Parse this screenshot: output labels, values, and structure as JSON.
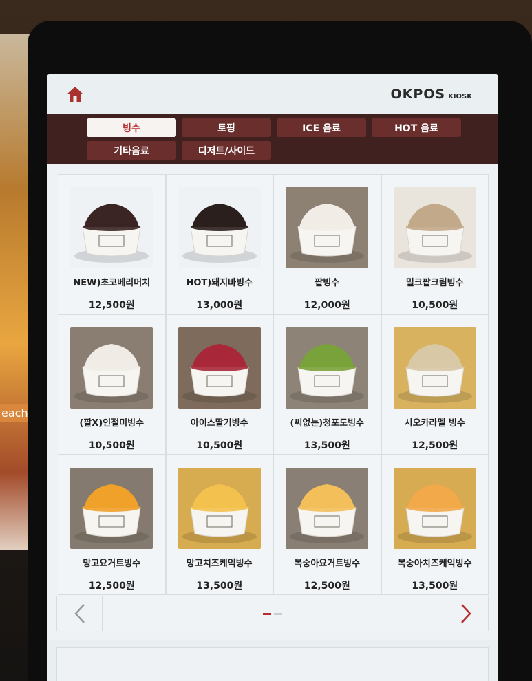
{
  "header": {
    "brand": "OKPOS",
    "brand_sub": "KIOSK"
  },
  "categories": [
    [
      "빙수",
      "토핑",
      "ICE 음료",
      "HOT 음료"
    ],
    [
      "기타음료",
      "디저트/사이드"
    ]
  ],
  "active_category": "빙수",
  "products": [
    {
      "name": "NEW)초코베리머치",
      "price": "12,500원",
      "bg": "#eef2f4",
      "topping": "#3a2424"
    },
    {
      "name": "HOT)돼지바빙수",
      "price": "13,000원",
      "bg": "#eef2f4",
      "topping": "#2a1f1c"
    },
    {
      "name": "팥빙수",
      "price": "12,000원",
      "bg": "#8d8174",
      "topping": "#f1ede6"
    },
    {
      "name": "밀크팥크림빙수",
      "price": "10,500원",
      "bg": "#e9e4dc",
      "topping": "#c2a98a"
    },
    {
      "name": "(팥X)인절미빙수",
      "price": "10,500원",
      "bg": "#8a7e72",
      "topping": "#f0ece5"
    },
    {
      "name": "아이스딸기빙수",
      "price": "10,500원",
      "bg": "#7e6b5c",
      "topping": "#a8283a"
    },
    {
      "name": "(씨없는)청포도빙수",
      "price": "13,500원",
      "bg": "#8d8377",
      "topping": "#79a23a"
    },
    {
      "name": "시오카라멜 빙수",
      "price": "12,500원",
      "bg": "#d8b25f",
      "topping": "#d8c8a6"
    },
    {
      "name": "망고요거트빙수",
      "price": "12,500원",
      "bg": "#857a6f",
      "topping": "#f0a12a"
    },
    {
      "name": "망고치즈케익빙수",
      "price": "13,500원",
      "bg": "#d7ab4f",
      "topping": "#f3c24e"
    },
    {
      "name": "복숭아요거트빙수",
      "price": "12,500원",
      "bg": "#8a7f74",
      "topping": "#f2bf5a"
    },
    {
      "name": "복숭아치즈케익빙수",
      "price": "13,500원",
      "bg": "#d6ab52",
      "topping": "#f2a94a"
    }
  ],
  "pagination": {
    "current": 1,
    "total": 2
  },
  "colors": {
    "category_bar": "#41211f",
    "category_button": "#6a2e2c",
    "accent_red": "#b62d2f"
  },
  "icons": {
    "home": "home-icon",
    "prev": "chevron-left-icon",
    "next": "chevron-right-icon"
  }
}
